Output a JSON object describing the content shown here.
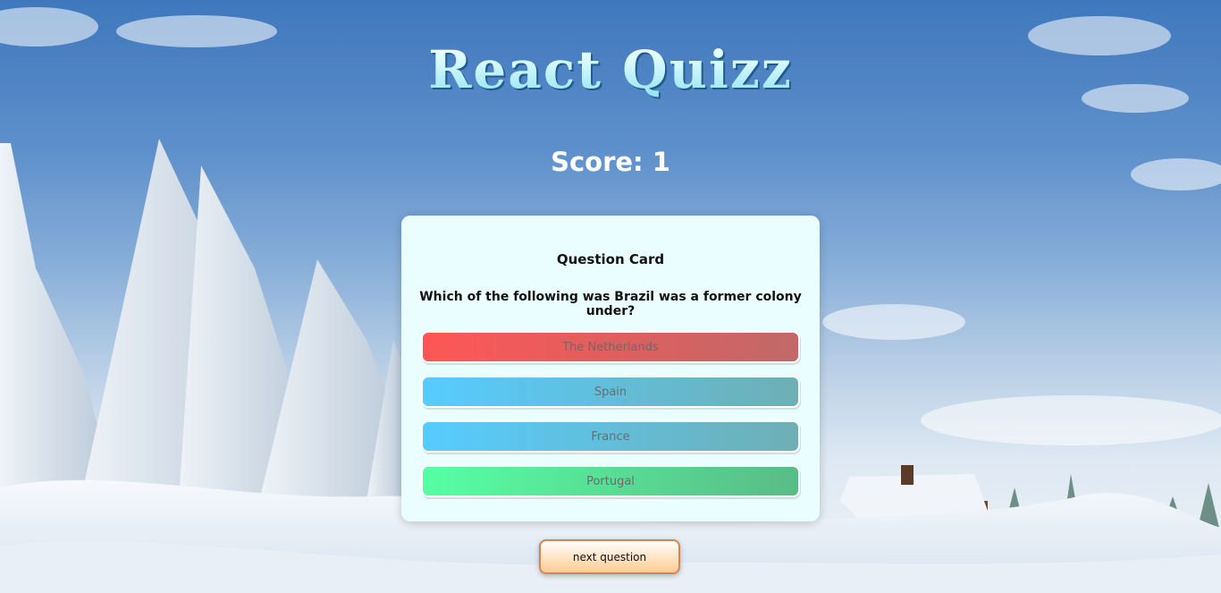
{
  "header": {
    "title": "React Quizz",
    "score_text": "Score: 1"
  },
  "question_card": {
    "heading": "Question Card",
    "question": "Which of the following was Brazil was a former colony under?",
    "answers": [
      {
        "label": "The Netherlands",
        "state": "incorrect"
      },
      {
        "label": "Spain",
        "state": "neutral"
      },
      {
        "label": "France",
        "state": "neutral"
      },
      {
        "label": "Portugal",
        "state": "correct"
      }
    ]
  },
  "controls": {
    "next_label": "next question"
  },
  "colors": {
    "incorrect": "#ff5656",
    "neutral": "#56ccff",
    "correct": "#56ffa4",
    "card_background": "#ebfeff",
    "next_button": "#ffcc91"
  }
}
